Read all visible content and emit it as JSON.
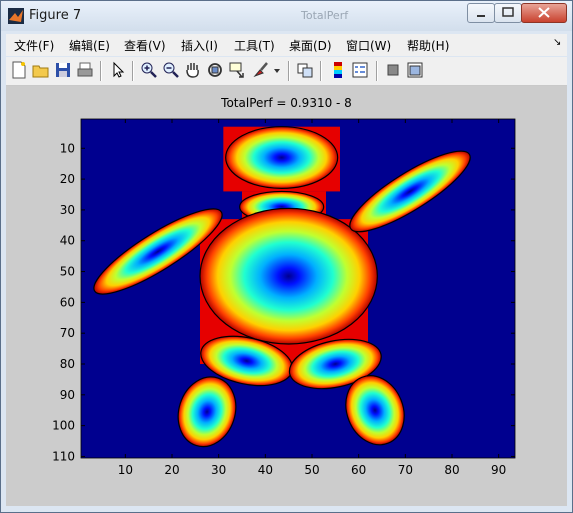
{
  "window": {
    "title": "Figure 7",
    "background_title": "TotalPerf"
  },
  "menu": [
    "文件(F)",
    "编辑(E)",
    "查看(V)",
    "插入(I)",
    "工具(T)",
    "桌面(D)",
    "窗口(W)",
    "帮助(H)"
  ],
  "menu_arrow": "↘",
  "toolbar_icons": [
    "new-figure-icon",
    "open-file-icon",
    "save-icon",
    "print-icon",
    "pointer-arrow-icon",
    "zoom-in-icon",
    "zoom-out-icon",
    "pan-hand-icon",
    "rotate-3d-icon",
    "data-cursor-icon",
    "brush-icon",
    "brush-dropdown-icon",
    "link-plot-icon",
    "colorbar-icon",
    "legend-icon",
    "hide-plot-tools-icon",
    "show-plot-tools-icon"
  ],
  "plot": {
    "title": "TotalPerf = 0.9310 - 8"
  },
  "chart_data": {
    "type": "heatmap",
    "title": "TotalPerf = 0.9310 - 8",
    "xlabel": "",
    "ylabel": "",
    "xlim": [
      0.5,
      93.5
    ],
    "ylim": [
      0.5,
      110.5
    ],
    "y_reversed": true,
    "xticks": [
      10,
      20,
      30,
      40,
      50,
      60,
      70,
      80,
      90
    ],
    "yticks": [
      10,
      20,
      30,
      40,
      50,
      60,
      70,
      80,
      90,
      100,
      110
    ],
    "colormap": "jet",
    "background_color": "#00008f",
    "grid": false,
    "blobs": [
      {
        "name": "head",
        "cx": 43.5,
        "cy": 13,
        "rx": 12,
        "ry": 10,
        "angle": 0,
        "fill_x": [
          31,
          56
        ],
        "fill_y": [
          3,
          24
        ]
      },
      {
        "name": "neck",
        "cx": 43.5,
        "cy": 29,
        "rx": 9,
        "ry": 5,
        "angle": 0,
        "fill_x": [
          35,
          53
        ],
        "fill_y": [
          24,
          34
        ]
      },
      {
        "name": "body",
        "cx": 45,
        "cy": 51.5,
        "rx": 19,
        "ry": 22,
        "angle": 0,
        "fill_x": [
          26,
          62
        ],
        "fill_y": [
          33,
          80
        ]
      },
      {
        "name": "left-arm",
        "cx": 17,
        "cy": 43.5,
        "rx": 16,
        "ry": 6,
        "angle": -32,
        "fill_x": [
          0,
          0
        ],
        "fill_y": [
          0,
          0
        ]
      },
      {
        "name": "right-arm",
        "cx": 71,
        "cy": 24,
        "rx": 15,
        "ry": 6,
        "angle": -32,
        "fill_x": [
          0,
          0
        ],
        "fill_y": [
          0,
          0
        ]
      },
      {
        "name": "left-hip",
        "cx": 36,
        "cy": 79,
        "rx": 10,
        "ry": 7.5,
        "angle": 12,
        "fill_x": [
          0,
          0
        ],
        "fill_y": [
          0,
          0
        ]
      },
      {
        "name": "right-hip",
        "cx": 55,
        "cy": 80,
        "rx": 10,
        "ry": 7.5,
        "angle": -12,
        "fill_x": [
          0,
          0
        ],
        "fill_y": [
          0,
          0
        ]
      },
      {
        "name": "left-leg",
        "cx": 27.5,
        "cy": 95.5,
        "rx": 6,
        "ry": 11.5,
        "angle": 18,
        "fill_x": [
          0,
          0
        ],
        "fill_y": [
          0,
          0
        ]
      },
      {
        "name": "right-leg",
        "cx": 63.5,
        "cy": 95,
        "rx": 6,
        "ry": 11.5,
        "angle": -22,
        "fill_x": [
          0,
          0
        ],
        "fill_y": [
          0,
          0
        ]
      }
    ]
  }
}
